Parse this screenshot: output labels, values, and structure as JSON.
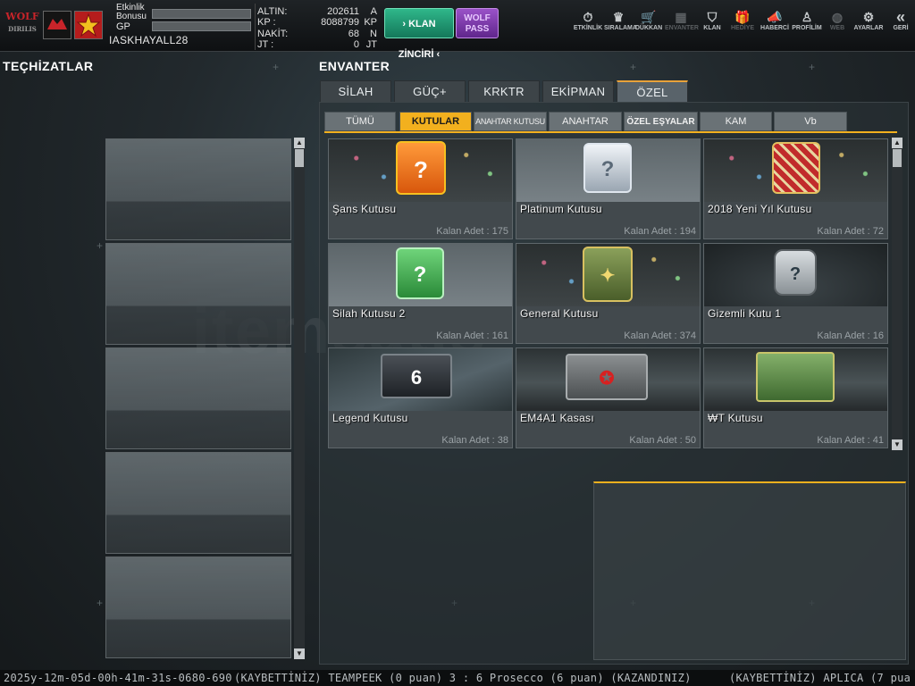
{
  "header": {
    "logo_text": "WOLF",
    "logo_sub": "DIRILIS",
    "etkinlik_label": "Etkinlik",
    "bonus_label": "Bonusu",
    "gp_label": "GP",
    "username": "IASKHAYALL28",
    "currencies": [
      {
        "label": "ALTIN:",
        "value": "202611",
        "unit": "A"
      },
      {
        "label": "KP   :",
        "value": "8088799",
        "unit": "KP"
      },
      {
        "label": "NAKİT:",
        "value": "68",
        "unit": "N"
      },
      {
        "label": "JT   :",
        "value": "0",
        "unit": "JT"
      }
    ],
    "klan_button": "› KLAN ZİNCİRİ ‹",
    "wolf_pass_line1": "WOLF",
    "wolf_pass_line2": "PASS"
  },
  "nav": [
    {
      "label": "ETKİNLİK",
      "icon": "stopwatch-icon",
      "glyph": "⏱",
      "enabled": true
    },
    {
      "label": "SIRALAMA",
      "icon": "rank-icon",
      "glyph": "♛",
      "enabled": true
    },
    {
      "label": "DÜKKAN",
      "icon": "cart-icon",
      "glyph": "🛒",
      "enabled": true
    },
    {
      "label": "ENVANTER",
      "icon": "inventory-icon",
      "glyph": "▦",
      "enabled": false
    },
    {
      "label": "KLAN",
      "icon": "shield-icon",
      "glyph": "⛉",
      "enabled": true
    },
    {
      "label": "HEDİYE",
      "icon": "gift-icon",
      "glyph": "🎁",
      "enabled": false
    },
    {
      "label": "HABERCİ",
      "icon": "megaphone-icon",
      "glyph": "📣",
      "enabled": true
    },
    {
      "label": "PROFİLİM",
      "icon": "profile-icon",
      "glyph": "♙",
      "enabled": true
    },
    {
      "label": "WEB",
      "icon": "globe-icon",
      "glyph": "◍",
      "enabled": false
    },
    {
      "label": "AYARLAR",
      "icon": "gear-icon",
      "glyph": "⚙",
      "enabled": true
    },
    {
      "label": "GERİ",
      "icon": "back-icon",
      "glyph": "«",
      "enabled": true
    }
  ],
  "left_title": "TEÇHİZATLAR",
  "right_title": "ENVANTER",
  "main_tabs": [
    {
      "label": "SİLAH",
      "active": false
    },
    {
      "label": "GÜÇ+",
      "active": false
    },
    {
      "label": "KRKTR",
      "active": false
    },
    {
      "label": "EKİPMAN",
      "active": false
    },
    {
      "label": "ÖZEL",
      "active": true
    }
  ],
  "sub_tabs": [
    {
      "label": "TÜMÜ",
      "active": false
    },
    {
      "label": "KUTULAR",
      "active": true
    },
    {
      "label": "ANAHTAR KUTUSU",
      "active": false
    },
    {
      "label": "ANAHTAR",
      "active": false
    },
    {
      "label": "ÖZEL EŞYALAR",
      "active": false
    },
    {
      "label": "KAM",
      "active": false
    },
    {
      "label": "Vb",
      "active": false
    }
  ],
  "items": [
    {
      "name": "Şans Kutusu",
      "count": "Kalan Adet : 175",
      "color": "#f07a1e"
    },
    {
      "name": "Platinum Kutusu",
      "count": "Kalan Adet : 194",
      "color": "#c9d2dc"
    },
    {
      "name": "2018 Yeni Yıl Kutusu",
      "count": "Kalan Adet : 72",
      "color": "#b82a2a"
    },
    {
      "name": "Silah Kutusu 2",
      "count": "Kalan Adet : 161",
      "color": "#3fa248"
    },
    {
      "name": "General Kutusu",
      "count": "Kalan Adet : 374",
      "color": "#5f7d3a"
    },
    {
      "name": "Gizemli Kutu 1",
      "count": "Kalan Adet : 16",
      "color": "#6c7a82"
    },
    {
      "name": "Legend Kutusu",
      "count": "Kalan Adet : 38",
      "color": "#3a3f44"
    },
    {
      "name": "EM4A1 Kasası",
      "count": "Kalan Adet : 50",
      "color": "#6a6e70"
    },
    {
      "name": "₩T Kutusu",
      "count": "Kalan Adet : 41",
      "color": "#4f7a3c"
    }
  ],
  "ticker": [
    "2025y-12m-05d-00h-41m-31s-0680-690",
    "(KAYBETTİNİZ) TEAMPEEK (0 puan) 3 : 6 Prosecco (6 puan) (KAZANDINIZ)",
    "(KAYBETTİNİZ) APLICA (7 pua"
  ],
  "watermark": "itemsatis"
}
